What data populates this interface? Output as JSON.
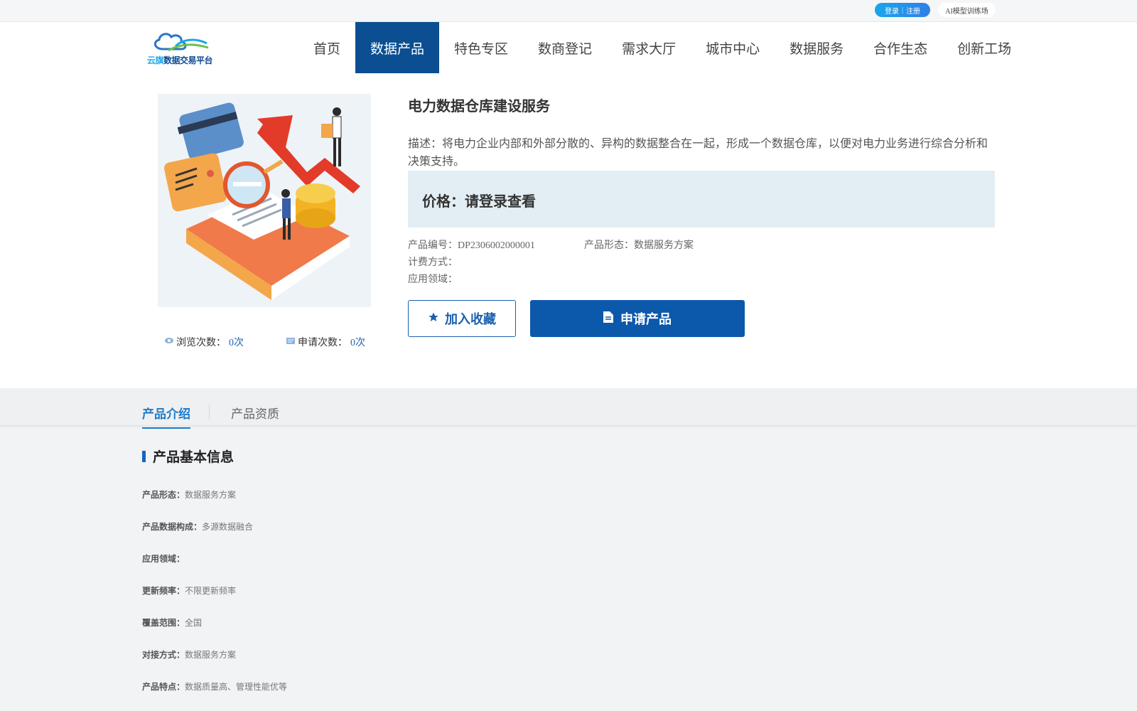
{
  "topbar": {
    "login": "登录",
    "separator": "|",
    "register": "注册",
    "ai_link": "AI模型训练场"
  },
  "logo": {
    "text_part1": "云旗",
    "text_part2": "数据交易平台"
  },
  "nav": {
    "items": [
      {
        "label": "首页",
        "active": false
      },
      {
        "label": "数据产品",
        "active": true
      },
      {
        "label": "特色专区",
        "active": false
      },
      {
        "label": "数商登记",
        "active": false
      },
      {
        "label": "需求大厅",
        "active": false
      },
      {
        "label": "城市中心",
        "active": false
      },
      {
        "label": "数据服务",
        "active": false
      },
      {
        "label": "合作生态",
        "active": false
      },
      {
        "label": "创新工场",
        "active": false
      }
    ]
  },
  "product": {
    "title": "电力数据仓库建设服务",
    "description": "描述：将电力企业内部和外部分散的、异构的数据整合在一起，形成一个数据仓库，以便对电力业务进行综合分析和决策支持。",
    "price": "价格：请登录查看",
    "code_label": "产品编号：",
    "code": "DP2306002000001",
    "form_label": "产品形态：",
    "form": "数据服务方案",
    "billing_label": "计费方式：",
    "billing": "",
    "domain_label": "应用领域：",
    "domain": "",
    "views_label": "浏览次数：",
    "views": "0次",
    "applies_label": "申请次数：",
    "applies": "0次",
    "favorite_button": "加入收藏",
    "apply_button": "申请产品"
  },
  "tabs": {
    "intro": "产品介绍",
    "qualification": "产品资质"
  },
  "info": {
    "section_title": "产品基本信息",
    "rows": [
      {
        "key": "产品形态：",
        "value": "数据服务方案"
      },
      {
        "key": "产品数据构成：",
        "value": "多源数据融合"
      },
      {
        "key": "应用领域：",
        "value": ""
      },
      {
        "key": "更新频率：",
        "value": "不限更新频率"
      },
      {
        "key": "覆盖范围：",
        "value": "全国"
      },
      {
        "key": "对接方式：",
        "value": "数据服务方案"
      },
      {
        "key": "产品特点：",
        "value": "数据质量高、管理性能优等"
      }
    ]
  },
  "colors": {
    "brand": "#0b4f92",
    "accent": "#1e7bc7",
    "price_bg": "#e3eef4"
  },
  "icons": [
    "eye-icon",
    "apply-icon",
    "star-icon",
    "document-icon",
    "logo-cloud-icon"
  ]
}
